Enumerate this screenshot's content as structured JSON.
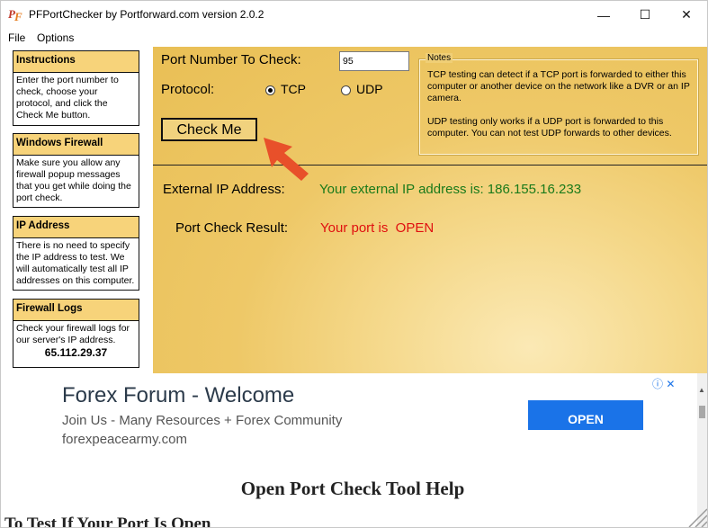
{
  "window": {
    "title": "PFPortChecker by Portforward.com version 2.0.2",
    "controls": {
      "minimize": "—",
      "maximize": "☐",
      "close": "✕"
    }
  },
  "menu": {
    "file": "File",
    "options": "Options"
  },
  "sidebar": {
    "instructions": {
      "title": "Instructions",
      "body": "Enter the port number to check, choose your protocol, and click the Check Me button."
    },
    "firewall": {
      "title": "Windows Firewall",
      "body": "Make sure you allow any firewall popup messages that you get while doing the port check."
    },
    "ip": {
      "title": "IP Address",
      "body": "There is no need to specify the IP address to test. We will automatically test all IP addresses on this computer."
    },
    "logs": {
      "title": "Firewall Logs",
      "body": "Check your firewall logs for our server's IP address.",
      "ip": "65.112.29.37"
    }
  },
  "main": {
    "port_label": "Port Number To Check:",
    "port_value": "95",
    "protocol_label": "Protocol:",
    "tcp_label": "TCP",
    "udp_label": "UDP",
    "check_button": "Check Me",
    "notes_title": "Notes",
    "notes_tcp": "TCP testing can detect if a TCP port is forwarded to either this computer or another device on the network like a DVR or an IP camera.",
    "notes_udp": "UDP testing only works if a UDP port is forwarded to this computer. You can not test UDP forwards to other devices.",
    "external_label": "External IP Address:",
    "external_value": "Your external IP address is: 186.155.16.233",
    "result_label": "Port Check Result:",
    "result_value": "Your port is  OPEN"
  },
  "ad": {
    "title": "Forex Forum - Welcome",
    "subtitle": "Join Us - Many Resources + Forex Community",
    "url": "forexpeacearmy.com",
    "open_button": "OPEN",
    "icons": "ⓘ ✕"
  },
  "help": {
    "heading": "Open Port Check Tool Help",
    "subheading": "To Test If Your Port Is Open"
  },
  "colors": {
    "panel_bg": "#eec867",
    "header_bg": "#f7d37a",
    "ip_text": "#1a7a1a",
    "result_text": "#e01010",
    "arrow": "#e8502a",
    "ad_button": "#1a73e8"
  },
  "icons": {
    "app": "pf-logo-icon",
    "arrow": "red-arrow-icon",
    "grip": "resize-grip-icon"
  }
}
